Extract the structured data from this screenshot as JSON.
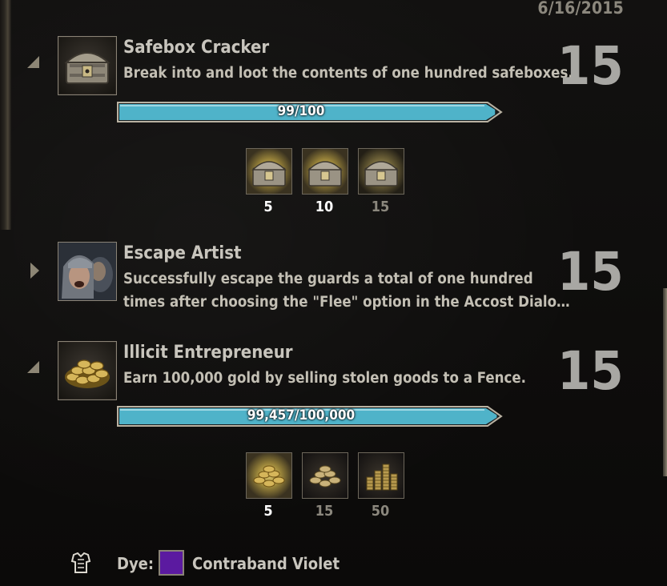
{
  "header": {
    "date": "6/16/2015"
  },
  "achievements": [
    {
      "title": "Safebox Cracker",
      "description_lines": [
        "Break into and loot the contents of one hundred safeboxes."
      ],
      "points": "15",
      "icon": "safebox-icon",
      "expanded": true,
      "progress": {
        "text": "99/100",
        "value": 99,
        "max": 100
      },
      "rewards": [
        {
          "label": "5",
          "icon": "safebox-icon",
          "completed": true
        },
        {
          "label": "10",
          "icon": "safebox-icon",
          "completed": true
        },
        {
          "label": "15",
          "icon": "safebox-icon",
          "completed": false
        }
      ]
    },
    {
      "title": "Escape Artist",
      "description_lines": [
        "Successfully escape the guards a total of one hundred",
        "times after choosing the \"Flee\" option in the Accost Dialo…"
      ],
      "points": "15",
      "icon": "guards-portrait-icon",
      "expanded": false
    },
    {
      "title": "Illicit Entrepreneur",
      "description_lines": [
        "Earn 100,000 gold by selling stolen goods to a Fence."
      ],
      "points": "15",
      "icon": "gold-coins-icon",
      "expanded": true,
      "progress": {
        "text": "99,457/100,000",
        "value": 99457,
        "max": 100000
      },
      "rewards": [
        {
          "label": "5",
          "icon": "gold-coins-icon",
          "completed": true
        },
        {
          "label": "15",
          "icon": "gold-coins-icon",
          "completed": false
        },
        {
          "label": "50",
          "icon": "gold-stacks-icon",
          "completed": false
        }
      ]
    }
  ],
  "dye_reward": {
    "label": "Dye:",
    "name": "Contraband Violet",
    "color": "#5b1aa0",
    "icon": "armor-chest-icon"
  },
  "colors": {
    "progress_fill": "#4fb3c9",
    "progress_border": "#b9b2a2",
    "points": "#a8a7a3"
  }
}
